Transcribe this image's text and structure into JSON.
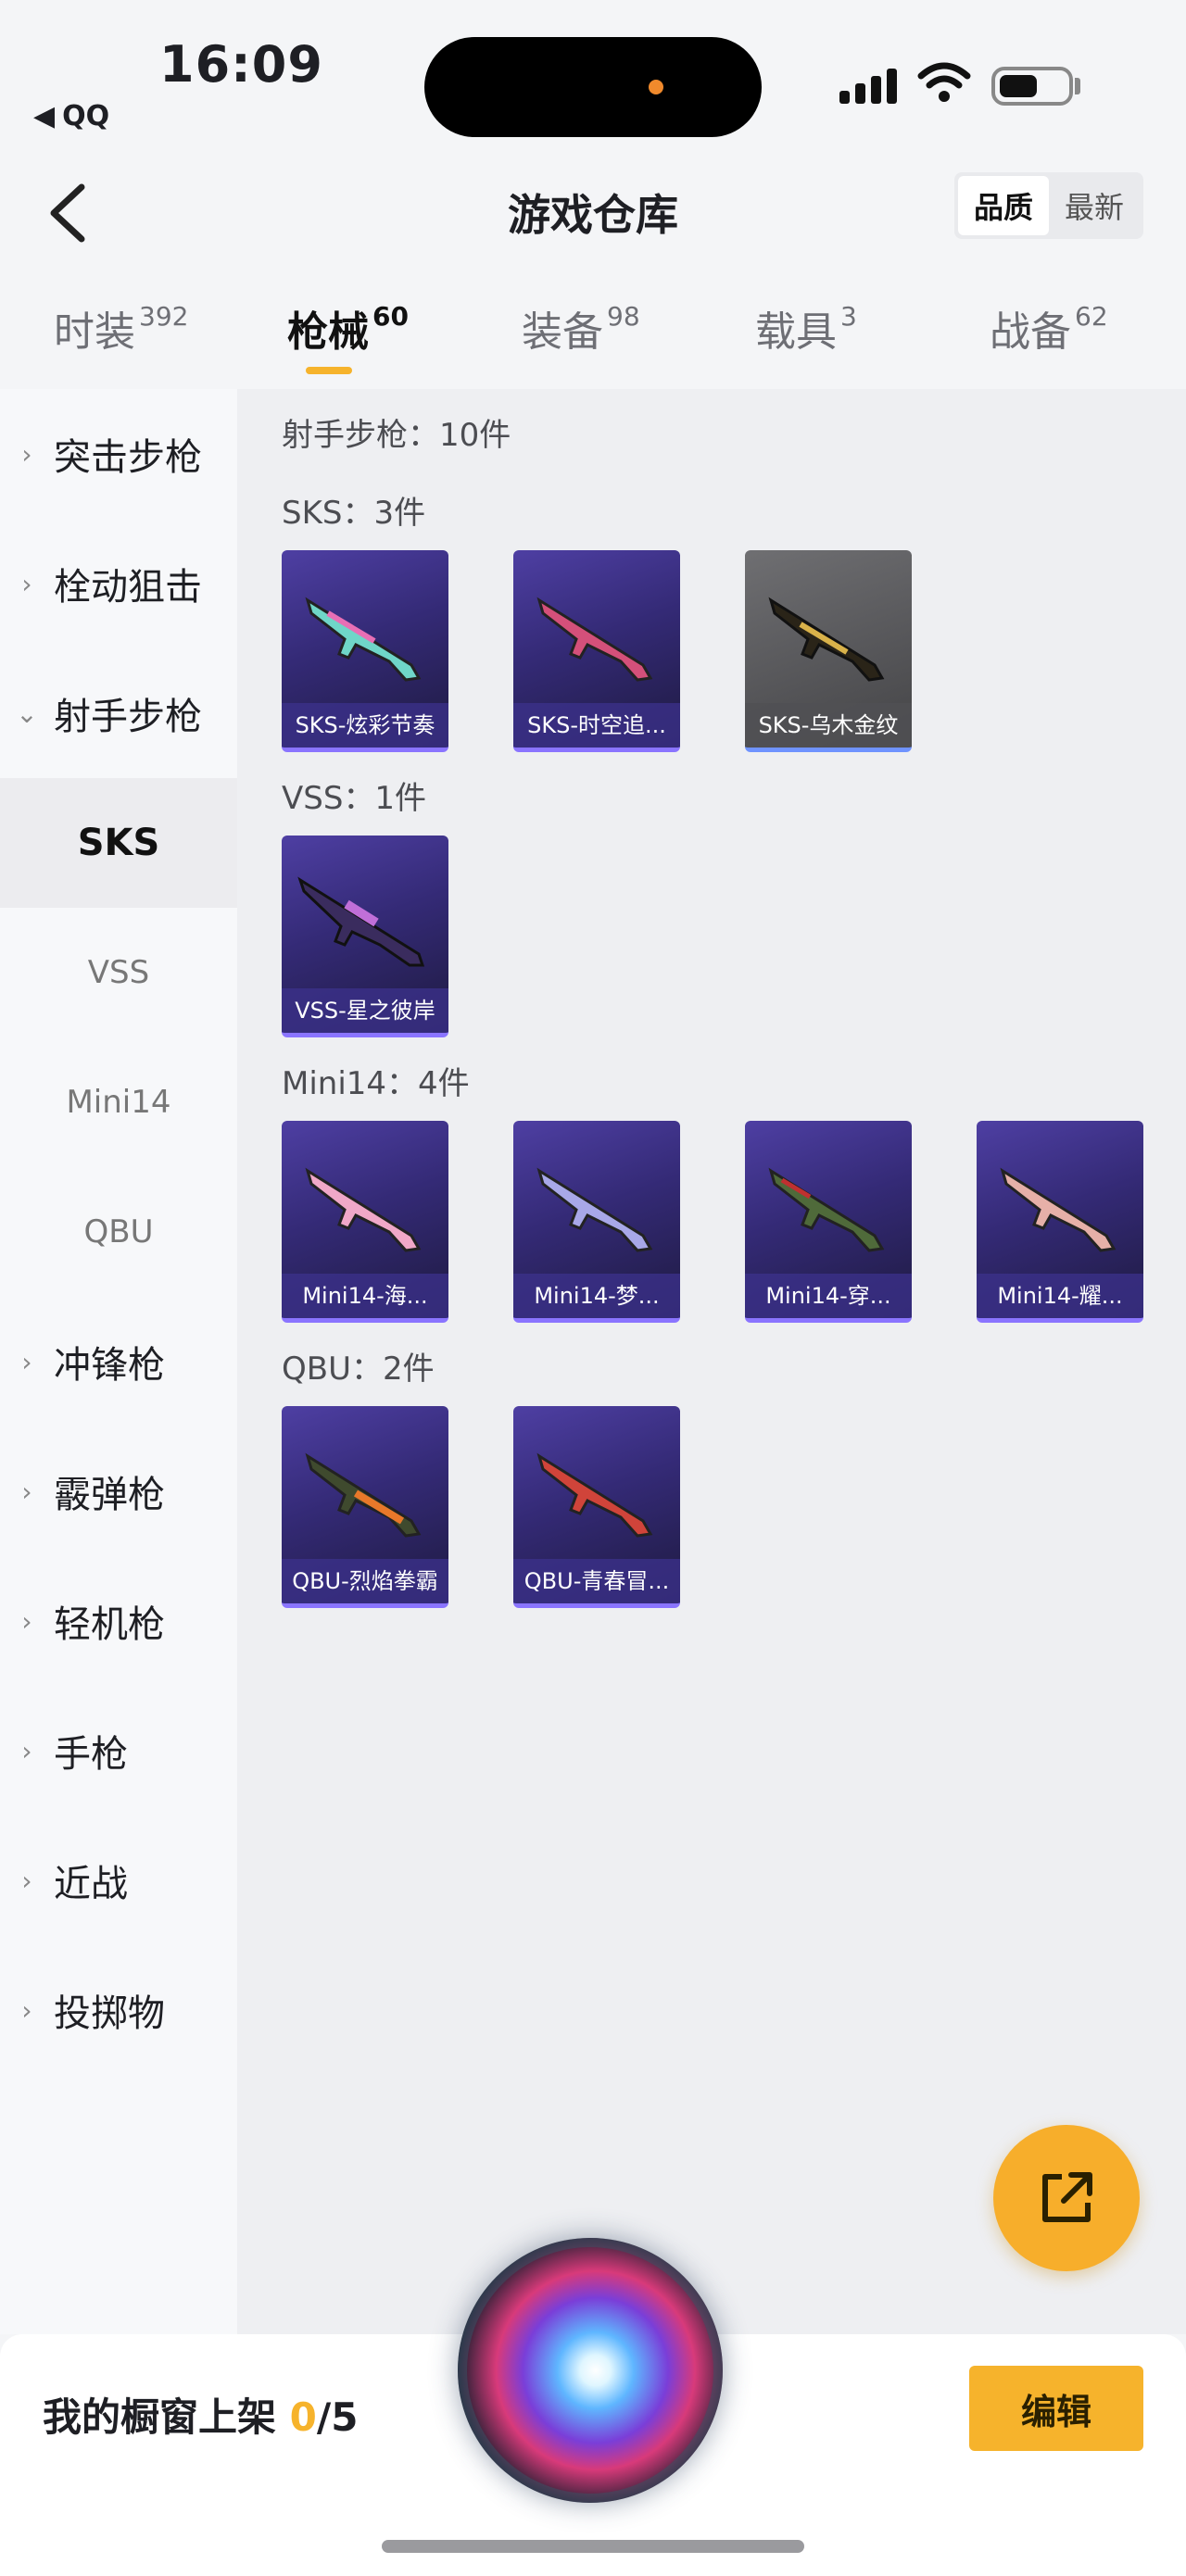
{
  "status_bar": {
    "time": "16:09",
    "back_app": "QQ"
  },
  "header": {
    "title": "游戏仓库",
    "sort": [
      "品质",
      "最新"
    ]
  },
  "tabs": [
    {
      "label": "时装",
      "count": "392"
    },
    {
      "label": "枪械",
      "count": "60"
    },
    {
      "label": "装备",
      "count": "98"
    },
    {
      "label": "载具",
      "count": "3"
    },
    {
      "label": "战备",
      "count": "62"
    }
  ],
  "sidebar": {
    "assault_rifle": "突击步枪",
    "bolt_sniper": "栓动狙击",
    "marksman_rifle": "射手步枪",
    "subs": [
      "SKS",
      "VSS",
      "Mini14",
      "QBU"
    ],
    "smg": "冲锋枪",
    "shotgun": "霰弹枪",
    "lmg": "轻机枪",
    "pistol": "手枪",
    "melee": "近战",
    "throwable": "投掷物"
  },
  "content": {
    "category_heading": "射手步枪：10件",
    "groups": [
      {
        "heading": "SKS：3件",
        "items": [
          "SKS-炫彩节奏",
          "SKS-时空追...",
          "SKS-乌木金纹"
        ]
      },
      {
        "heading": "VSS：1件",
        "items": [
          "VSS-星之彼岸"
        ]
      },
      {
        "heading": "Mini14：4件",
        "items": [
          "Mini14-海...",
          "Mini14-梦...",
          "Mini14-穿...",
          "Mini14-耀..."
        ]
      },
      {
        "heading": "QBU：2件",
        "items": [
          "QBU-烈焰拳霸",
          "QBU-青春冒..."
        ]
      }
    ]
  },
  "bottom_bar": {
    "shelf_label": "我的橱窗上架 ",
    "shelf_count": "0",
    "shelf_total": "/5",
    "edit": "编辑"
  },
  "colors": {
    "accent": "#f6b32c",
    "card_purple": "#4e3fa3",
    "card_gray": "#6f6f72"
  }
}
